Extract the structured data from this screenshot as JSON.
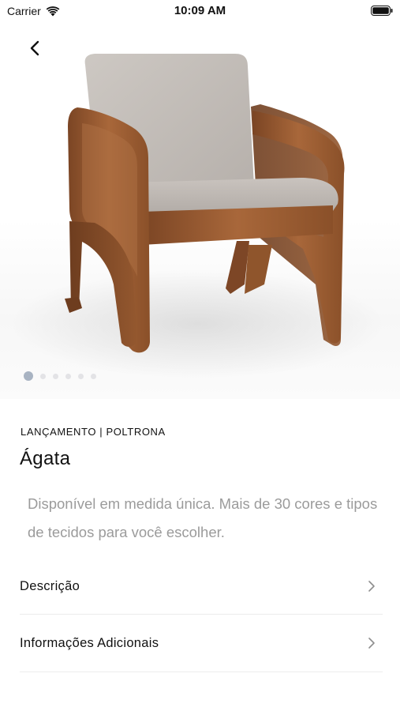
{
  "status_bar": {
    "carrier": "Carrier",
    "time": "10:09 AM",
    "wifi_icon": "wifi-icon",
    "battery_icon": "battery-icon"
  },
  "navigation": {
    "back_icon": "chevron-left-icon"
  },
  "gallery": {
    "image": "armchair-photo",
    "page_count": 6,
    "active_index": 0,
    "active_color": "#a8b3c2",
    "inactive_color": "#e3e3e6"
  },
  "product": {
    "category": "LANÇAMENTO | POLTRONA",
    "name": "Ágata",
    "description": "Disponível em medida única. Mais de 30 cores e tipos de tecidos para você escolher."
  },
  "sections": [
    {
      "label": "Descrição",
      "icon": "chevron-right-icon"
    },
    {
      "label": "Informações Adicionais",
      "icon": "chevron-right-icon"
    }
  ]
}
